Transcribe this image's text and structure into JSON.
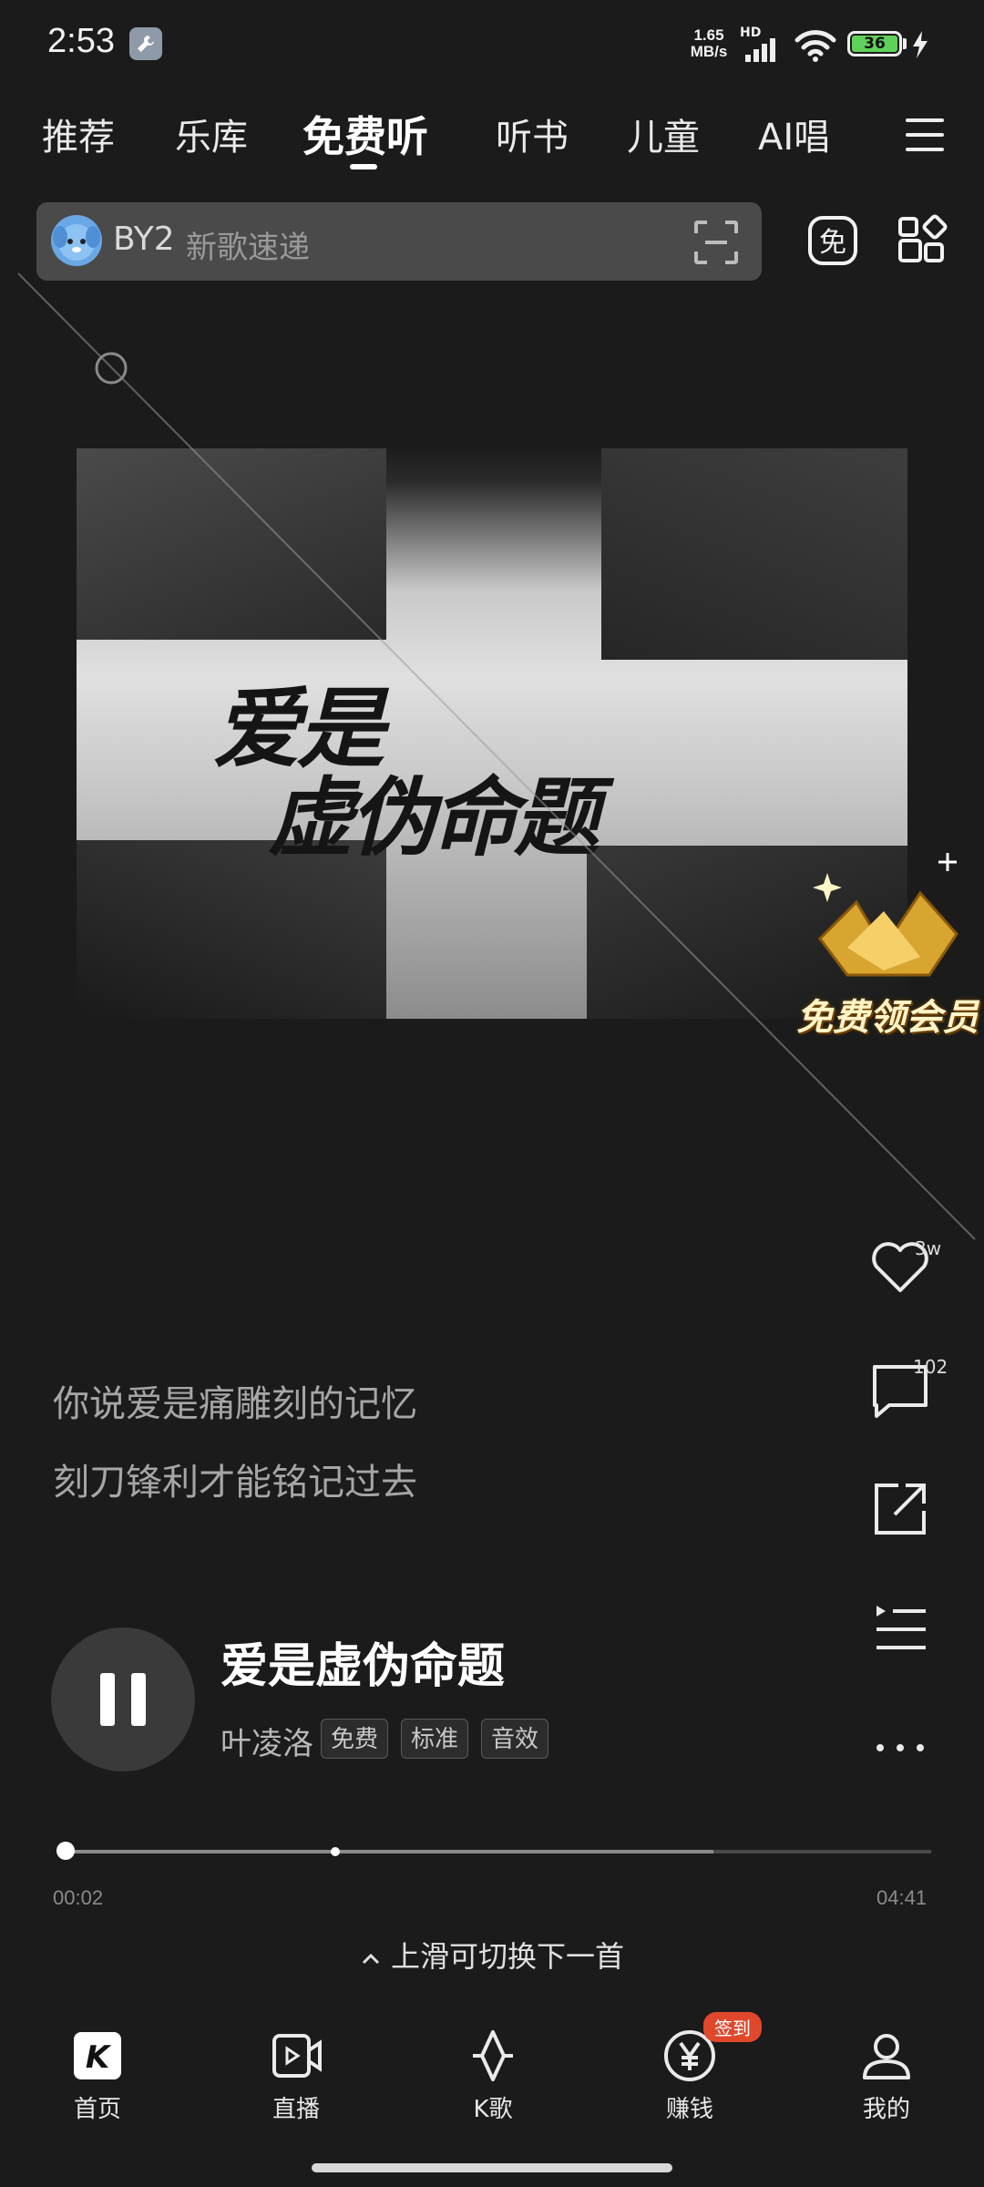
{
  "status_bar": {
    "time": "2:53",
    "net_speed_value": "1.65",
    "net_speed_unit": "MB/s",
    "hd": "HD",
    "battery": "36"
  },
  "tabs": [
    {
      "label": "推荐"
    },
    {
      "label": "乐库"
    },
    {
      "label": "免费听"
    },
    {
      "label": "听书"
    },
    {
      "label": "儿童"
    },
    {
      "label": "AI唱"
    }
  ],
  "search": {
    "keyword": "BY2",
    "placeholder": "新歌速递"
  },
  "artwork": {
    "title_line1": "爱是",
    "title_line2": "虚伪命题"
  },
  "vip_badge": {
    "label": "免费领会员"
  },
  "side_actions": {
    "like_count": "3w",
    "comment_count": "102"
  },
  "lyrics": [
    "你说爱是痛雕刻的记忆",
    "刻刀锋利才能铭记过去"
  ],
  "player": {
    "song_title": "爱是虚伪命题",
    "artist": "叶凌洛",
    "tags": [
      "免费",
      "标准",
      "音效"
    ],
    "current_time": "00:02",
    "total_time": "04:41",
    "progress_fraction": 0.008,
    "buffered_fraction": 0.75,
    "swipe_hint": "上滑可切换下一首"
  },
  "bottom_nav": [
    {
      "label": "首页",
      "icon": "home-k-icon"
    },
    {
      "label": "直播",
      "icon": "live-icon"
    },
    {
      "label": "K歌",
      "icon": "karaoke-icon"
    },
    {
      "label": "赚钱",
      "icon": "yen-coin-icon",
      "badge": "签到"
    },
    {
      "label": "我的",
      "icon": "profile-icon"
    }
  ],
  "colors": {
    "background": "#1b1b1b",
    "accent_badge": "#e0482c",
    "battery": "#5fd05a"
  }
}
